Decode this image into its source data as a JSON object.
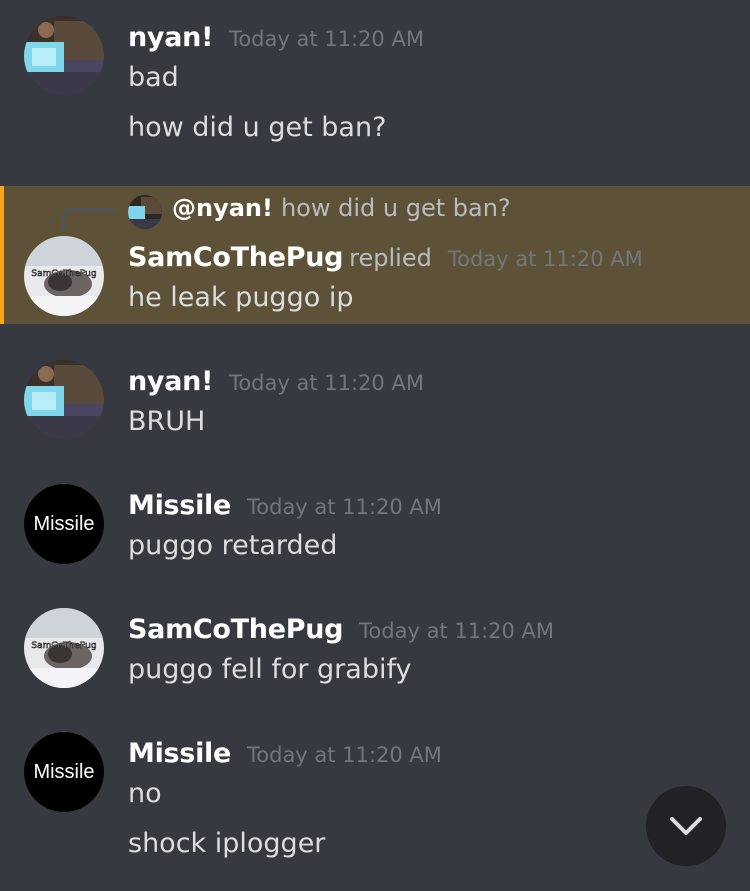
{
  "messages": [
    {
      "username": "nyan!",
      "timestamp": "Today at 11:20 AM",
      "lines": [
        "bad",
        "how did u get ban?"
      ]
    },
    {
      "reply": {
        "mention": "@nyan!",
        "text": "how did u get ban?"
      },
      "username": "SamCoThePug",
      "replied_label": "replied",
      "timestamp": "Today at 11:20 AM",
      "lines": [
        "he leak puggo ip"
      ],
      "highlight_color": "#5d5238",
      "accent_color": "#faa61a"
    },
    {
      "username": "nyan!",
      "timestamp": "Today at 11:20 AM",
      "lines": [
        "BRUH"
      ]
    },
    {
      "username": "Missile",
      "timestamp": "Today at 11:20 AM",
      "lines": [
        "puggo retarded"
      ],
      "avatar_text": "Missile"
    },
    {
      "username": "SamCoThePug",
      "timestamp": "Today at 11:20 AM",
      "lines": [
        "puggo fell for grabify"
      ]
    },
    {
      "username": "Missile",
      "timestamp": "Today at 11:20 AM",
      "lines": [
        "no",
        "shock iplogger"
      ],
      "avatar_text": "Missile"
    }
  ],
  "avatars": {
    "nyan": "nyan-avatar (screen/laptop photo)",
    "samco": "pug-avatar",
    "samco_caption": "SamCoThePug"
  },
  "scroll_button": {
    "icon": "chevron-down-icon"
  },
  "colors": {
    "background": "#36393f",
    "username": "#ffffff",
    "timestamp": "#72767d",
    "message_text": "#dcddde"
  }
}
